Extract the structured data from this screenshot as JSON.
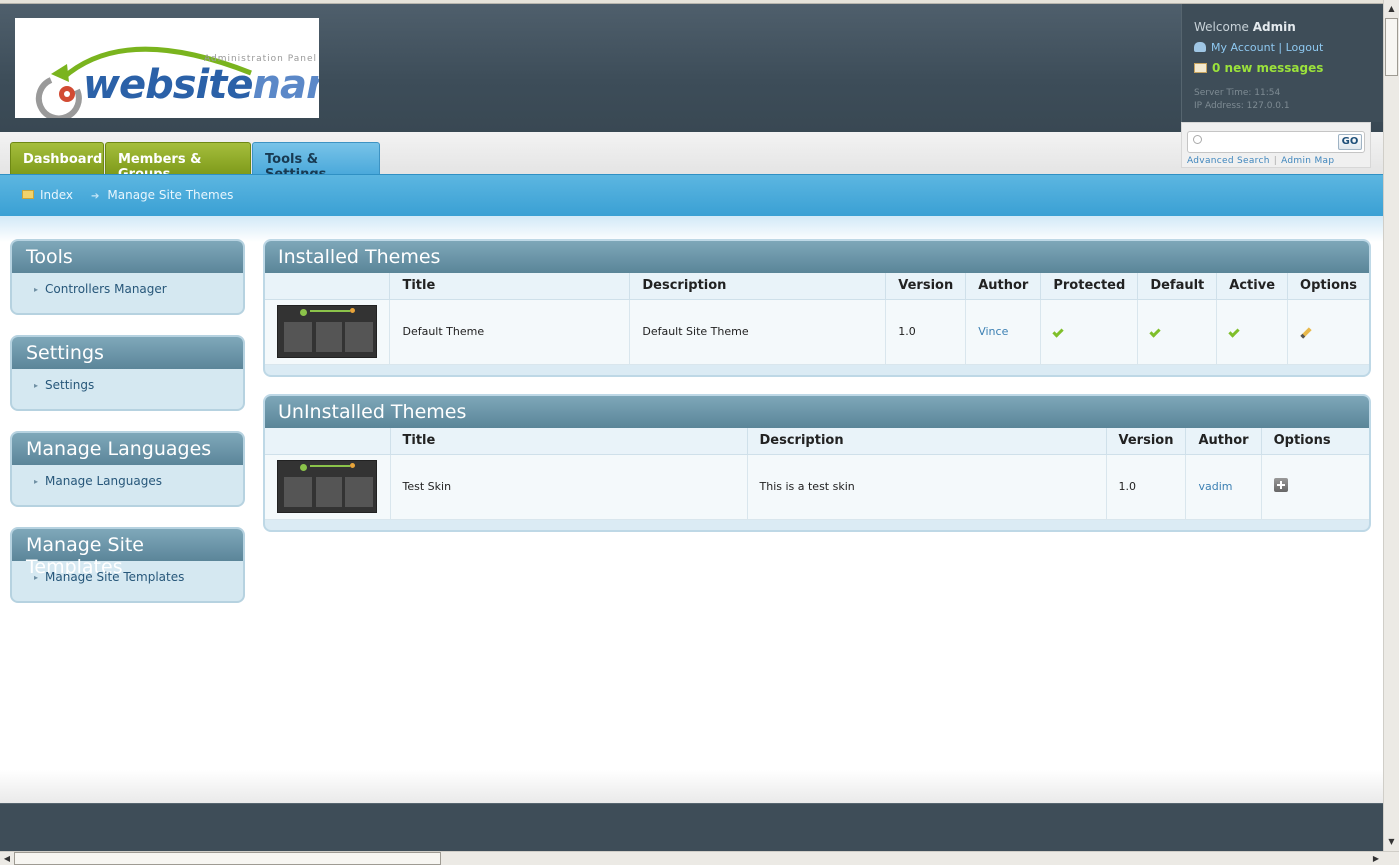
{
  "header": {
    "logo": {
      "word1": "website",
      "word2": "name",
      "subtitle": "Administration Panel"
    },
    "user": {
      "welcome": "Welcome",
      "name": "Admin",
      "my_account": "My Account",
      "logout": "Logout",
      "messages": "0 new messages",
      "server_time": "Server Time: 11:54",
      "ip_address": "IP Address: 127.0.0.1"
    }
  },
  "search": {
    "placeholder": "",
    "go": "GO",
    "advanced": "Advanced Search",
    "admin_map": "Admin Map"
  },
  "tabs": [
    {
      "label": "Dashboard",
      "active": false
    },
    {
      "label": "Members & Groups",
      "active": false
    },
    {
      "label": "Tools & Settings",
      "active": true
    }
  ],
  "breadcrumb": {
    "index": "Index",
    "current": "Manage Site Themes"
  },
  "sidebar": [
    {
      "title": "Tools",
      "items": [
        "Controllers Manager"
      ]
    },
    {
      "title": "Settings",
      "items": [
        "Settings"
      ]
    },
    {
      "title": "Manage Languages",
      "items": [
        "Manage Languages"
      ]
    },
    {
      "title": "Manage Site Templates",
      "items": [
        "Manage Site Templates"
      ]
    }
  ],
  "installed": {
    "title": "Installed Themes",
    "columns": [
      "",
      "Title",
      "Description",
      "Version",
      "Author",
      "Protected",
      "Default",
      "Active",
      "Options"
    ],
    "rows": [
      {
        "title": "Default Theme",
        "description": "Default Site Theme",
        "version": "1.0",
        "author": "Vince",
        "protected": true,
        "default": true,
        "active": true,
        "option_icon": "edit-pencil-icon"
      }
    ]
  },
  "uninstalled": {
    "title": "UnInstalled Themes",
    "columns": [
      "",
      "Title",
      "Description",
      "Version",
      "Author",
      "Options"
    ],
    "rows": [
      {
        "title": "Test Skin",
        "description": "This is a test skin",
        "version": "1.0",
        "author": "vadim",
        "option_icon": "install-plus-icon"
      }
    ]
  },
  "colors": {
    "header_bg": "#3d4d59",
    "tab_green": "#8aa527",
    "tab_active": "#5bb2df",
    "crumb_bar": "#43a6d8",
    "link_green": "#9be23b"
  }
}
